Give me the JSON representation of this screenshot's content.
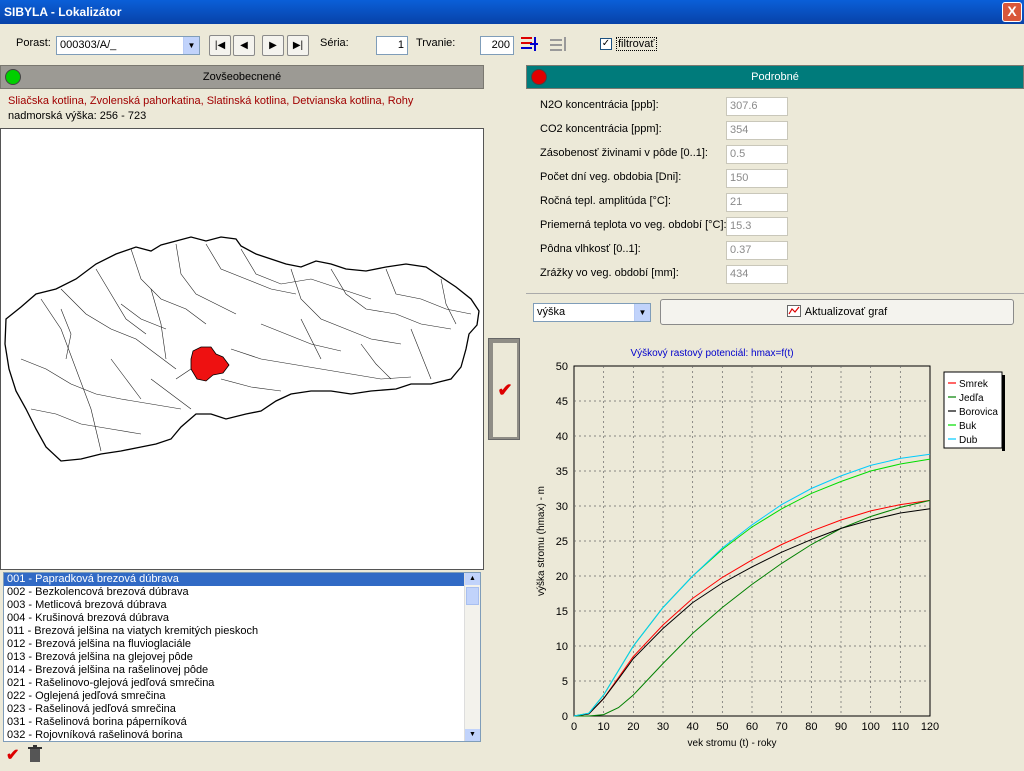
{
  "window": {
    "title": "SIBYLA - Lokalizátor",
    "close_label": "X"
  },
  "toolbar": {
    "porast_label": "Porast:",
    "porast_value": "000303/A/_",
    "seria_label": "Séria:",
    "seria_value": "1",
    "trvanie_label": "Trvanie:",
    "trvanie_value": "200",
    "filtrovat_label": "filtrovať",
    "filtrovat_checked": true,
    "nav": [
      "|◀",
      "◀",
      "▶",
      "▶|"
    ]
  },
  "left_panel": {
    "header": "Zovšeobecnené",
    "regions": "Sliačska kotlina, Zvolenská pahorkatina, Slatinská kotlina, Detvianska kotlina, Rohy",
    "altitude": "nadmorská výška: 256 - 723",
    "list_items": [
      "001 - Papradková brezová dúbrava",
      "002 - Bezkolencová brezová dúbrava",
      "003 - Metlicová brezová dúbrava",
      "004 - Krušinová brezová dúbrava",
      "011 - Brezová jelšina na viatych kremitých pieskoch",
      "012 - Brezová jelšina na fluvioglaciále",
      "013 - Brezová jelšina na glejovej pôde",
      "014 - Brezová jelšina na rašelinovej pôde",
      "021 - Rašelinovo-glejová jedľová smrečina",
      "022 - Oglejená jedľová smrečina",
      "023 - Rašelinová jedľová smrečina",
      "031 - Rašelinová borina páperníková",
      "032 - Rojovníková rašelinová borina"
    ]
  },
  "right_panel": {
    "header": "Podrobné",
    "params": [
      {
        "label": "N2O koncentrácia [ppb]:",
        "value": "307.6"
      },
      {
        "label": "CO2 koncentrácia [ppm]:",
        "value": "354"
      },
      {
        "label": "Zásobenosť živinami v pôde [0..1]:",
        "value": "0.5"
      },
      {
        "label": "Počet dní veg. obdobia [Dni]:",
        "value": "150"
      },
      {
        "label": "Ročná tepl. amplitúda [°C]:",
        "value": "21"
      },
      {
        "label": "Priemerná teplota vo veg. období [°C]:",
        "value": "15.3"
      },
      {
        "label": "Pôdna vlhkosť [0..1]:",
        "value": "0.37"
      },
      {
        "label": "Zrážky vo veg. období [mm]:",
        "value": "434"
      }
    ],
    "graph_select": "výška",
    "update_button": "Aktualizovať graf"
  },
  "chart_data": {
    "type": "line",
    "title": "Výškový rastový potenciál: hmax=f(t)",
    "xlabel": "vek stromu (t) - roky",
    "ylabel": "výška stromu (hmax) - m",
    "xlim": [
      0,
      120
    ],
    "ylim": [
      0,
      50
    ],
    "xticks": [
      0,
      10,
      20,
      30,
      40,
      50,
      60,
      70,
      80,
      90,
      100,
      110,
      120
    ],
    "yticks": [
      0,
      5,
      10,
      15,
      20,
      25,
      30,
      35,
      40,
      45,
      50
    ],
    "grid": true,
    "legend_position": "top-right",
    "x": [
      0,
      5,
      10,
      15,
      20,
      30,
      40,
      50,
      60,
      70,
      80,
      90,
      100,
      110,
      120
    ],
    "series": [
      {
        "name": "Smrek",
        "color": "#ff0000",
        "values": [
          0,
          0.3,
          2.5,
          5.5,
          8.5,
          13,
          16.8,
          19.8,
          22.3,
          24.5,
          26.4,
          28,
          29.3,
          30.2,
          30.8
        ]
      },
      {
        "name": "Jedľa",
        "color": "#008000",
        "values": [
          0,
          0,
          0.2,
          1.2,
          3,
          7.5,
          11.8,
          15.5,
          18.8,
          21.8,
          24.5,
          26.8,
          28.5,
          29.8,
          30.8
        ]
      },
      {
        "name": "Borovica",
        "color": "#000000",
        "values": [
          0,
          0.3,
          2.5,
          5.3,
          8.2,
          12.5,
          16.2,
          19,
          21.3,
          23.4,
          25.2,
          26.8,
          28,
          29,
          29.6
        ]
      },
      {
        "name": "Buk",
        "color": "#00dd00",
        "values": [
          0,
          0.4,
          3,
          6.5,
          10,
          15.5,
          20,
          23.8,
          27,
          29.6,
          31.8,
          33.5,
          35,
          36,
          36.7
        ]
      },
      {
        "name": "Dub",
        "color": "#00ccff",
        "values": [
          0,
          0.4,
          3,
          6.5,
          10,
          15.5,
          20,
          24,
          27.3,
          30.2,
          32.5,
          34.3,
          35.8,
          36.8,
          37.4
        ]
      }
    ]
  }
}
